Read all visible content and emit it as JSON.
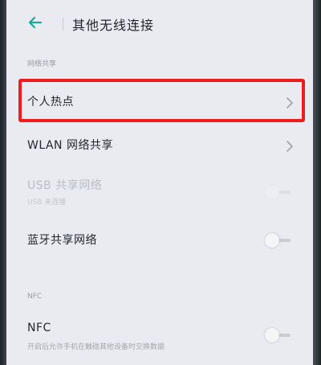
{
  "header": {
    "title": "其他无线连接",
    "back_icon": "arrow-left-icon"
  },
  "sections": {
    "network_sharing": "网络共享",
    "nfc": "NFC"
  },
  "items": {
    "hotspot": {
      "label": "个人热点"
    },
    "wlan_sharing": {
      "label": "WLAN 网络共享"
    },
    "usb_sharing": {
      "label": "USB 共享网络",
      "sub": "USB 未连接",
      "enabled": false
    },
    "bt_sharing": {
      "label": "蓝牙共享网络",
      "on": false
    },
    "nfc": {
      "label": "NFC",
      "sub": "开启后允许手机在触碰其他设备时交换数据",
      "on": false
    }
  },
  "colors": {
    "accent": "#1aa89a",
    "highlight": "#ee1c1c",
    "background": "#eaebf0"
  }
}
